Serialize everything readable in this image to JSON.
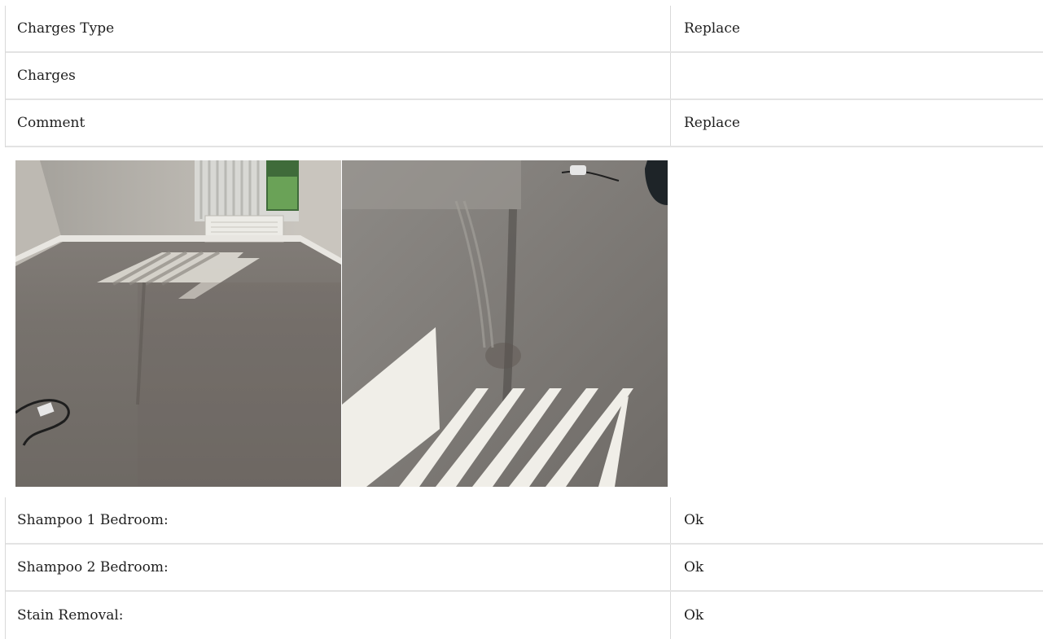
{
  "details_top": [
    {
      "label": "Charges Type",
      "value": "Replace"
    },
    {
      "label": "Charges",
      "value": ""
    },
    {
      "label": "Comment",
      "value": "Replace"
    }
  ],
  "photos": [
    {
      "name": "room-carpet-photo"
    },
    {
      "name": "carpet-closeup-photo"
    }
  ],
  "details_bottom": [
    {
      "label": "Shampoo 1 Bedroom:",
      "value": "Ok"
    },
    {
      "label": "Shampoo 2 Bedroom:",
      "value": "Ok"
    },
    {
      "label": "Stain Removal:",
      "value": "Ok"
    }
  ]
}
